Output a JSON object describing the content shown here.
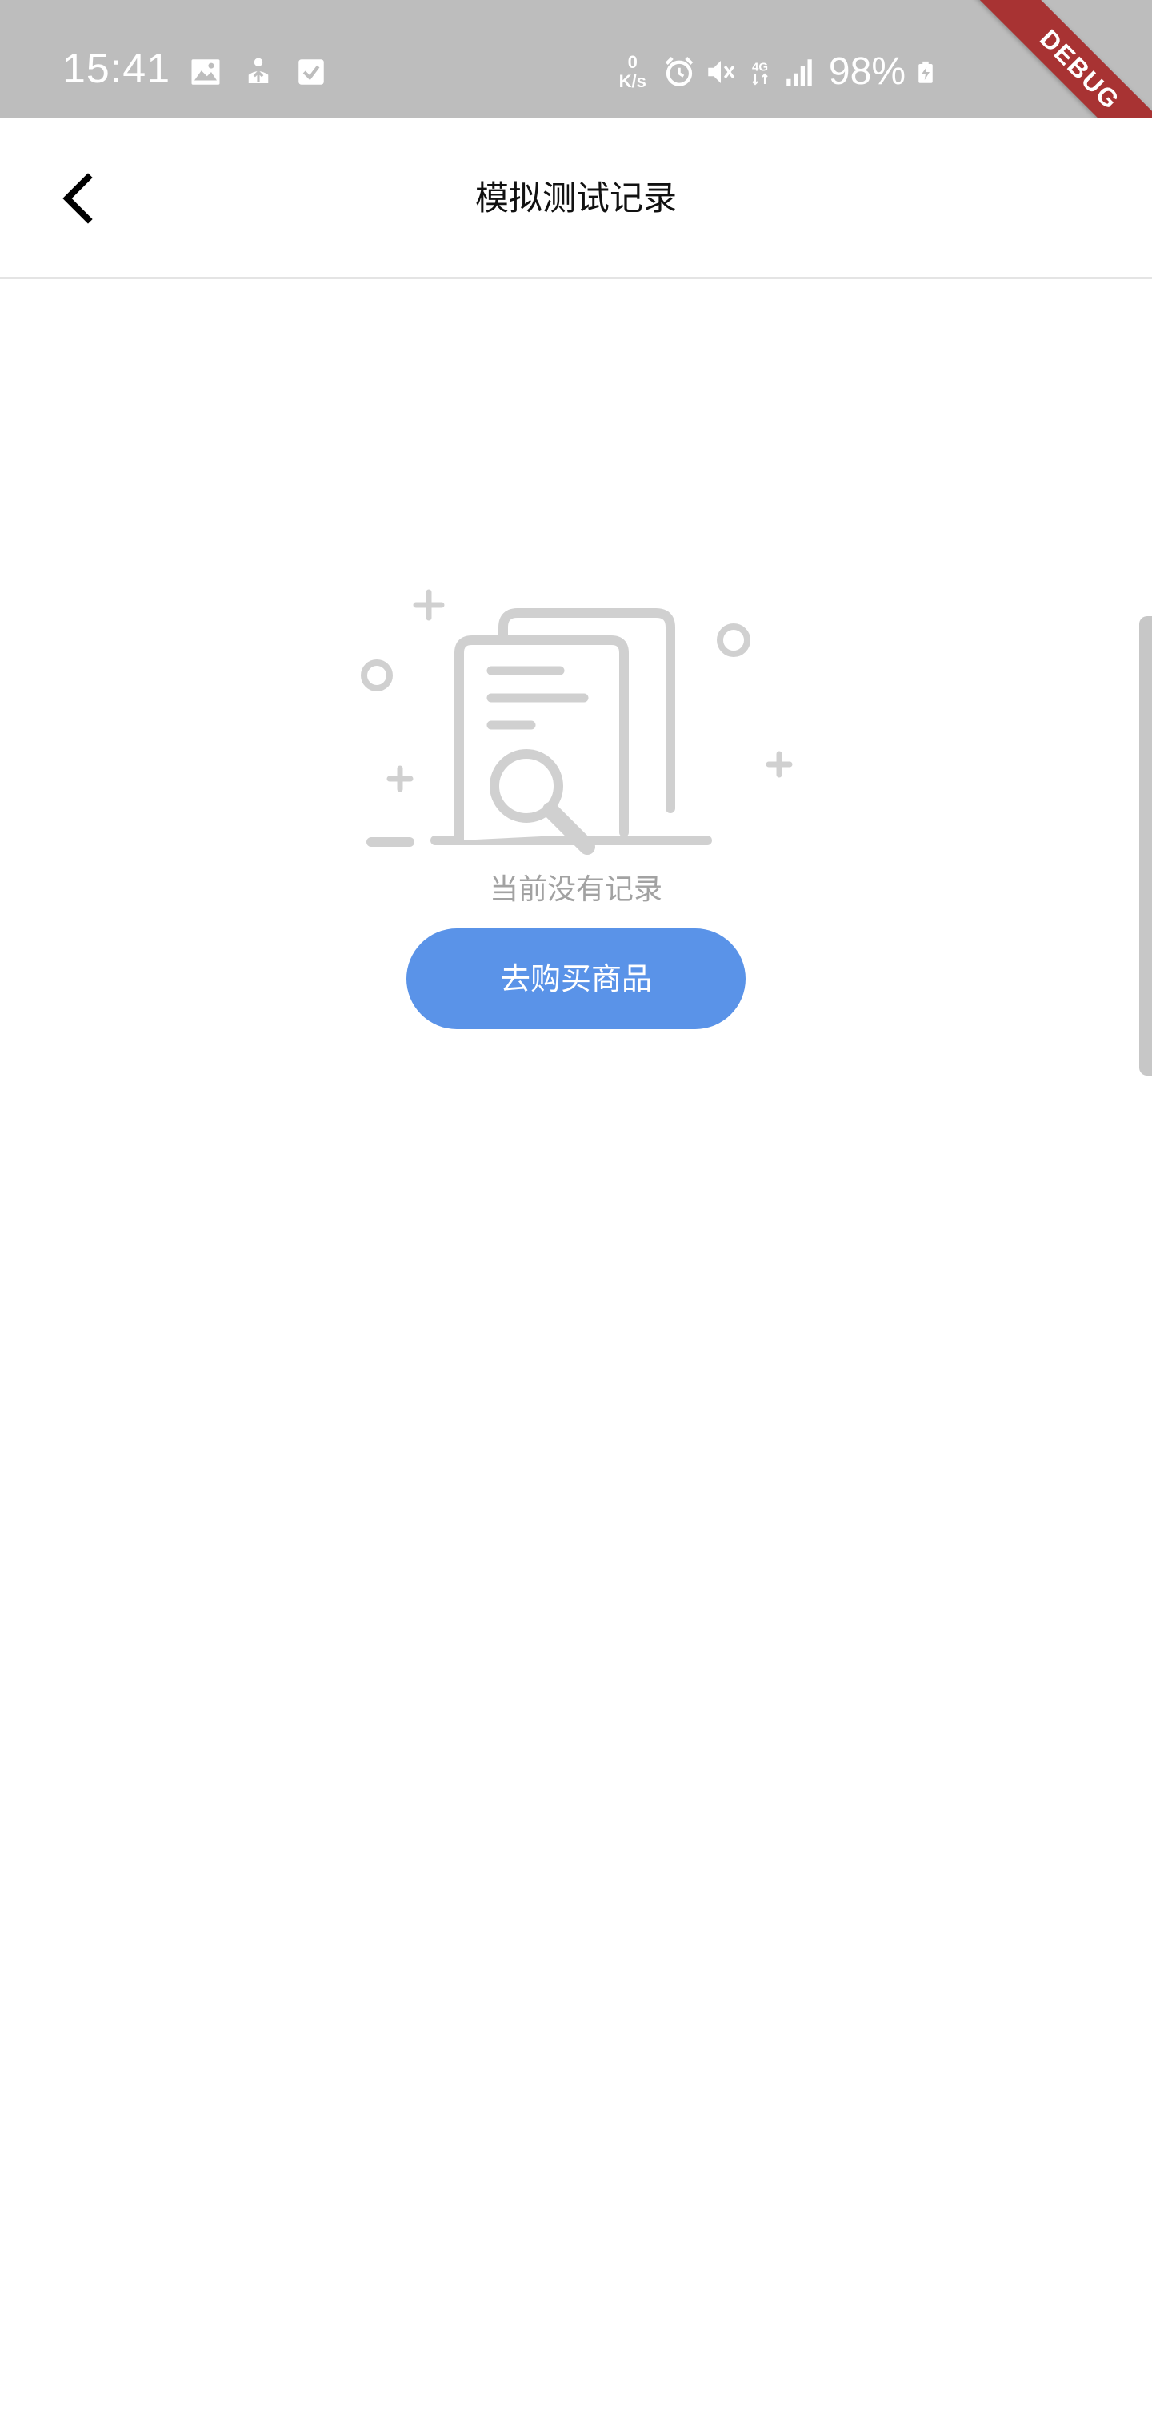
{
  "status_bar": {
    "time": "15:41",
    "net_speed_value": "0",
    "net_speed_unit": "K/s",
    "network_type": "4G",
    "battery_percent": "98%",
    "icons": [
      "gallery-icon",
      "upload-icon",
      "checkbox-icon",
      "alarm-icon",
      "mute-icon",
      "4g-icon",
      "signal-icon",
      "battery-charging-icon"
    ]
  },
  "debug_banner": "DEBUG",
  "app_bar": {
    "title": "模拟测试记录",
    "back_icon": "back-chevron-icon"
  },
  "empty_state": {
    "illustration": "empty-records-illustration",
    "message": "当前没有记录",
    "action_label": "去购买商品"
  },
  "colors": {
    "status_bar": "#bdbdbd",
    "accent": "#5a93e8",
    "debug": "#a83333",
    "muted_text": "#a2a2a2",
    "illustration": "#d0d0d0"
  }
}
